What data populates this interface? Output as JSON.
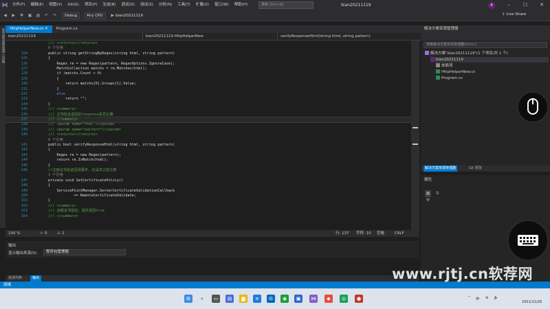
{
  "menubar": {
    "logo": "⋈",
    "items": [
      "文件(F)",
      "编辑(E)",
      "视图(V)",
      "Git(G)",
      "项目(P)",
      "生成(B)",
      "调试(D)",
      "测试(S)",
      "分析(N)",
      "工具(T)",
      "扩展(X)",
      "窗口(W)",
      "帮助(H)"
    ],
    "search_placeholder": "搜索 (Ctrl+Q)",
    "project_name": "bian20211119",
    "user_initial": "4"
  },
  "toolbar": {
    "config": "Debug",
    "platform": "Any CPU",
    "run_target": "bian20211119",
    "live_share": "Live Share"
  },
  "tabs": [
    {
      "label": "HttpHelperNew.cs",
      "active": true
    },
    {
      "label": "Program.cs",
      "active": false
    }
  ],
  "navbar": {
    "project": "bian20211119",
    "class": "bian20211119.HttpHelperNew",
    "member": "verifyResponseHtml(string html, string pattern)"
  },
  "left_rail_label": "服务器资源管理器 工具箱",
  "code_lines": [
    {
      "n": "",
      "t": "/// <returns></returns>",
      "cls": "cm"
    },
    {
      "n": "",
      "t": "0 个引用",
      "cls": "ref"
    },
    {
      "n": "124",
      "t": "public string getStringByRegex(string html, string pattern)",
      "cls": "pl"
    },
    {
      "n": "125",
      "t": "{",
      "cls": "pl"
    },
    {
      "n": "126",
      "t": "    Regex re = new Regex(pattern, RegexOptions.IgnoreCase);",
      "cls": "pl"
    },
    {
      "n": "127",
      "t": "    MatchCollection matchs = re.Matches(html);",
      "cls": "pl"
    },
    {
      "n": "128",
      "t": "    if (matchs.Count > 0)",
      "cls": "pl"
    },
    {
      "n": "129",
      "t": "    {",
      "cls": "pl"
    },
    {
      "n": "130",
      "t": "        return matchs[0].Groups[1].Value;",
      "cls": "pl"
    },
    {
      "n": "131",
      "t": "    }",
      "cls": "pl"
    },
    {
      "n": "132",
      "t": "    else",
      "cls": "kw"
    },
    {
      "n": "133",
      "t": "        return \"\";",
      "cls": "pl"
    },
    {
      "n": "134",
      "t": "}",
      "cls": "pl"
    },
    {
      "n": "135",
      "t": "/// <summary>",
      "cls": "cm"
    },
    {
      "n": "136",
      "t": "/// 正则验证返回的response是否正确",
      "cls": "cm"
    },
    {
      "n": "137",
      "t": "/// </summary>",
      "cls": "cm"
    },
    {
      "n": "138",
      "t": "/// <param name=\"html\"></param>",
      "cls": "cm"
    },
    {
      "n": "139",
      "t": "/// <param name=\"pattern\"></param>",
      "cls": "cm"
    },
    {
      "n": "140",
      "t": "/// <returns></returns>",
      "cls": "cm"
    },
    {
      "n": "",
      "t": "0 个引用",
      "cls": "ref"
    },
    {
      "n": "141",
      "t": "public bool verifyResponseHtml(string html, string pattern)",
      "cls": "pl"
    },
    {
      "n": "142",
      "t": "{",
      "cls": "pl"
    },
    {
      "n": "143",
      "t": "    Regex re = new Regex(pattern);",
      "cls": "pl"
    },
    {
      "n": "144",
      "t": "    return re.IsMatch(html);",
      "cls": "pl"
    },
    {
      "n": "145",
      "t": "}",
      "cls": "pl"
    },
    {
      "n": "146",
      "t": "//注册证书验证回调事件，在请求之前注册",
      "cls": "cm"
    },
    {
      "n": "",
      "t": "3 个引用",
      "cls": "ref"
    },
    {
      "n": "147",
      "t": "private void SetCertificatePolicy()",
      "cls": "pl"
    },
    {
      "n": "148",
      "t": "{",
      "cls": "pl"
    },
    {
      "n": "149",
      "t": "    ServicePointManager.ServerCertificateValidationCallback",
      "cls": "pl"
    },
    {
      "n": "150",
      "t": "            += RemoteCertificateValidate;",
      "cls": "pl"
    },
    {
      "n": "151",
      "t": "}",
      "cls": "pl"
    },
    {
      "n": "152",
      "t": "/// <summary>",
      "cls": "cm"
    },
    {
      "n": "153",
      "t": "/// 远程证书验证，固定返回true",
      "cls": "cm"
    },
    {
      "n": "154",
      "t": "/// </summary>",
      "cls": "cm"
    }
  ],
  "editor_status": {
    "zoom": "100 %",
    "errors": "0",
    "warnings": "1",
    "line": "行: 137",
    "char": "字符: 10",
    "spaces": "空格",
    "crlf": "CRLF"
  },
  "output": {
    "title": "输出",
    "source_label": "显示输出来源(S):",
    "source_value": "程序包管理器"
  },
  "bottom_tabs": [
    "错误列表",
    "输出"
  ],
  "status": {
    "ready": "就绪"
  },
  "solution": {
    "title": "解决方案资源管理器",
    "search_placeholder": "搜索解决方案资源管理器(Ctrl+;)",
    "nodes": [
      {
        "label": "解决方案\"bian20211119\"(1 个项目/共 1 个)",
        "indent": 0,
        "icon": "solution-icon"
      },
      {
        "label": "bian20211119",
        "indent": 1,
        "icon": "csharp-project-icon",
        "selected": true
      },
      {
        "label": "依赖项",
        "indent": 2,
        "icon": "dependencies-icon"
      },
      {
        "label": "HttpHelperNew.cs",
        "indent": 2,
        "icon": "csharp-file-icon"
      },
      {
        "label": "Program.cs",
        "indent": 2,
        "icon": "csharp-file-icon"
      }
    ],
    "tabs": [
      "解决方案资源管理器",
      "Git 更改"
    ]
  },
  "properties": {
    "title": "属性"
  },
  "taskbar": {
    "tray_lang": "中",
    "date": "2021/11/29"
  },
  "watermark": "www.rjtj.cn软荐网",
  "colors": {
    "accent": "#007acc",
    "vs_purple": "#68217a"
  }
}
